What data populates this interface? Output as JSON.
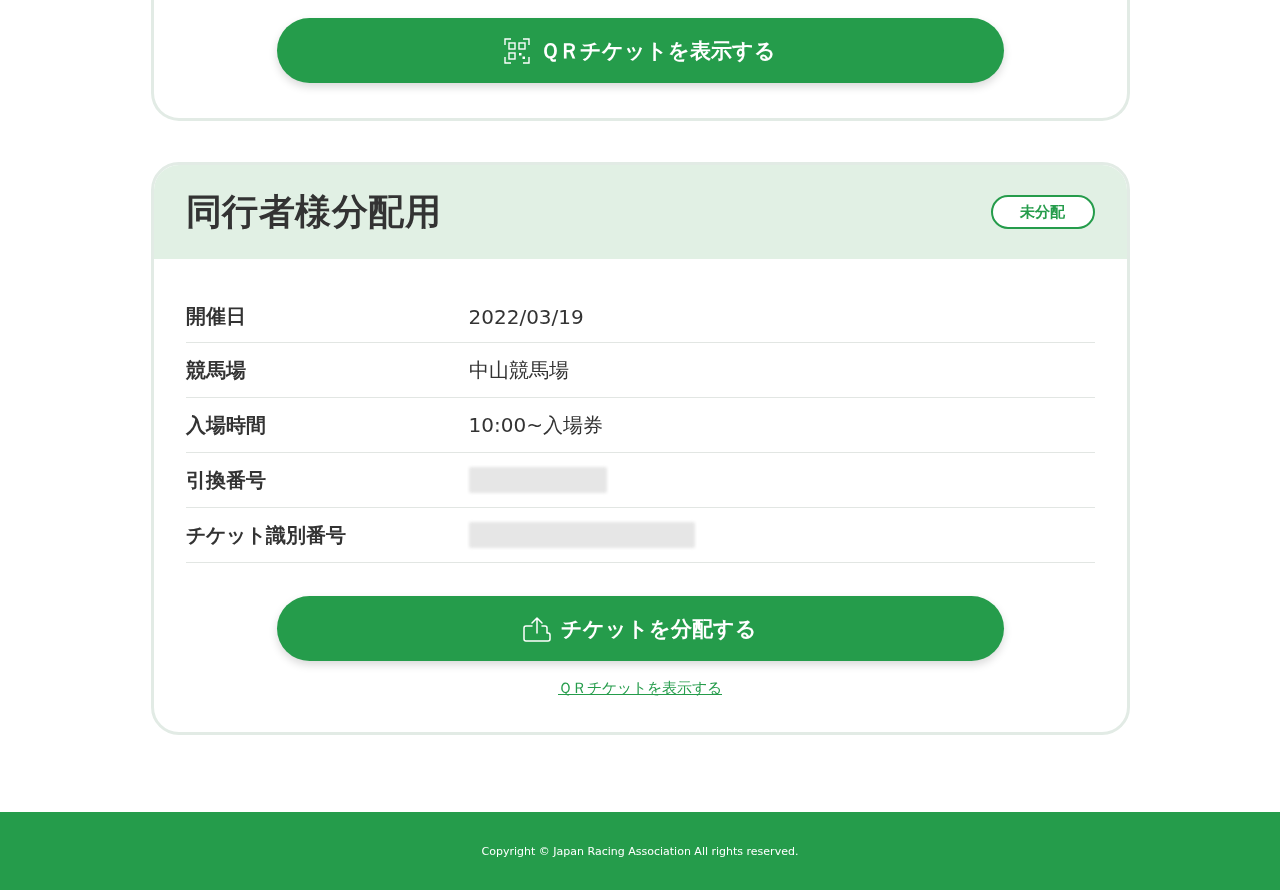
{
  "top_card": {
    "qr_button": {
      "label": "ＱＲチケットを表示する"
    }
  },
  "companion_card": {
    "title": "同行者様分配用",
    "status_badge": "未分配",
    "details": [
      {
        "kind": "text",
        "label": "開催日",
        "value": "2022/03/19"
      },
      {
        "kind": "text",
        "label": "競馬場",
        "value": "中山競馬場"
      },
      {
        "kind": "text",
        "label": "入場時間",
        "value": "10:00~入場券"
      },
      {
        "kind": "blurred",
        "label": "引換番号"
      },
      {
        "kind": "blurred",
        "label": "チケット識別番号"
      }
    ],
    "distribute_button": {
      "label": "チケットを分配する"
    },
    "qr_link": "ＱＲチケットを表示する"
  },
  "footer": {
    "copyright": "Copyright © Japan Racing Association All rights reserved."
  }
}
